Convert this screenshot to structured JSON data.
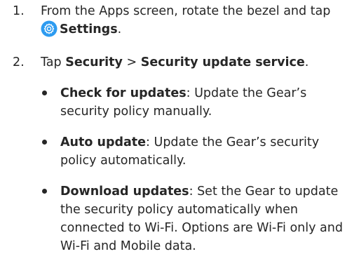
{
  "steps": [
    {
      "number": "1.",
      "text_before": "From the Apps screen, rotate the bezel and tap",
      "icon": "settings-gear-icon",
      "bold": "Settings",
      "text_after": "."
    },
    {
      "number": "2.",
      "text_before": "Tap",
      "bold1": "Security",
      "separator": ">",
      "bold2": "Security update service",
      "text_after": "."
    }
  ],
  "bullets": [
    {
      "term": "Check for updates",
      "description": ": Update the Gear’s security policy manually."
    },
    {
      "term": "Auto update",
      "description": ": Update the Gear’s security policy automatically."
    },
    {
      "term": "Download updates",
      "description": ": Set the Gear to update the security policy automatically when connected to Wi-Fi. Options are Wi-Fi only and Wi-Fi and Mobile data."
    }
  ],
  "colors": {
    "text": "#262626",
    "icon_blue": "#2d9bf0"
  }
}
